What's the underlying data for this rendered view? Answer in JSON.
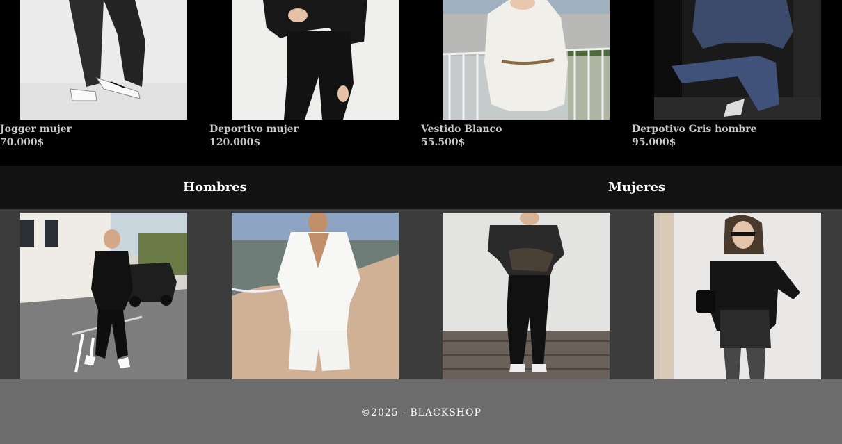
{
  "products": [
    {
      "name": "Jogger mujer",
      "price": "70.000$",
      "image": "woman in dark grey wide jogger pants and white sneakers"
    },
    {
      "name": "Deportivo mujer",
      "price": "120.000$",
      "image": "woman in black hoodie and black jogger set"
    },
    {
      "name": "Vestido Blanco",
      "price": "55.500$",
      "image": "woman in white knit sweater dress with belt on balcony"
    },
    {
      "name": "Derpotivo Gris hombre",
      "price": "95.000$",
      "image": "man in blue-grey tracksuit sitting in gym"
    }
  ],
  "categories": {
    "men_label": "Hombres",
    "women_label": "Mujeres"
  },
  "gallery": [
    {
      "image": "man in black shirt and black pants on street"
    },
    {
      "image": "man in white linen shirt and shorts on beach"
    },
    {
      "image": "woman in graphic tee and black flared jeans"
    },
    {
      "image": "woman in black blazer, leather shorts and polka dot tights"
    }
  ],
  "footer": {
    "copyright": "©2025 - BLACKSHOP"
  },
  "colors": {
    "products_bg": "#000000",
    "categories_bg": "#121212",
    "gallery_bg": "#3c3c3c",
    "footer_bg": "#6c6c6c"
  }
}
